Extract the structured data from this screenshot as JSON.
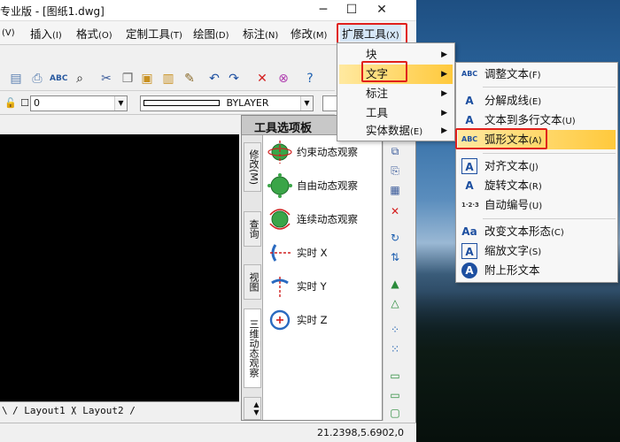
{
  "window": {
    "title": "专业版 - [图纸1.dwg]",
    "minimize": "─",
    "maximize": "☐",
    "close": "✕"
  },
  "menubar": [
    {
      "label": "(V)",
      "key": ""
    },
    {
      "label": "插入",
      "key": "(I)"
    },
    {
      "label": "格式",
      "key": "(O)"
    },
    {
      "label": "定制工具",
      "key": "(T)"
    },
    {
      "label": "绘图",
      "key": "(D)"
    },
    {
      "label": "标注",
      "key": "(N)"
    },
    {
      "label": "修改",
      "key": "(M)"
    },
    {
      "label": "扩展工具",
      "key": "(X)"
    }
  ],
  "layerbar": {
    "layer_value": "0",
    "linetype_value": "BYLAYER"
  },
  "palette": {
    "title": "工具选项板",
    "tabs": [
      "修改(M)",
      "查询",
      "视图",
      "三维动态观察"
    ],
    "tools": [
      "约束动态观察",
      "自由动态观察",
      "连续动态观察",
      "实时 X",
      "实时 Y",
      "实时 Z"
    ]
  },
  "layout_tabs": [
    "Layout1",
    "Layout2"
  ],
  "status": {
    "coords": "21.2398,5.6902,0"
  },
  "extend_menu": [
    {
      "label": "块",
      "key": ""
    },
    {
      "label": "文字",
      "key": ""
    },
    {
      "label": "标注",
      "key": ""
    },
    {
      "label": "工具",
      "key": ""
    },
    {
      "label": "实体数据",
      "key": "(E)"
    }
  ],
  "text_submenu": [
    {
      "label": "调整文本",
      "key": "(F)",
      "icon": "ABC"
    },
    {
      "label": "分解成线",
      "key": "(E)",
      "icon": "A"
    },
    {
      "label": "文本到多行文本",
      "key": "(U)",
      "icon": "A"
    },
    {
      "label": "弧形文本",
      "key": "(A)",
      "icon": "ABC"
    },
    {
      "label": "对齐文本",
      "key": "(J)",
      "icon": "A"
    },
    {
      "label": "旋转文本",
      "key": "(R)",
      "icon": "A"
    },
    {
      "label": "自动编号",
      "key": "(U)",
      "icon": "1·2·3"
    },
    {
      "label": "改变文本形态",
      "key": "(C)",
      "icon": "Aa"
    },
    {
      "label": "缩放文字",
      "key": "(S)",
      "icon": "A"
    },
    {
      "label": "附上形文本",
      "key": "",
      "icon": "A"
    }
  ],
  "colors": {
    "highlight": "#ffd86a",
    "callout": "#e0201c",
    "drawing_bg": "#000000"
  }
}
